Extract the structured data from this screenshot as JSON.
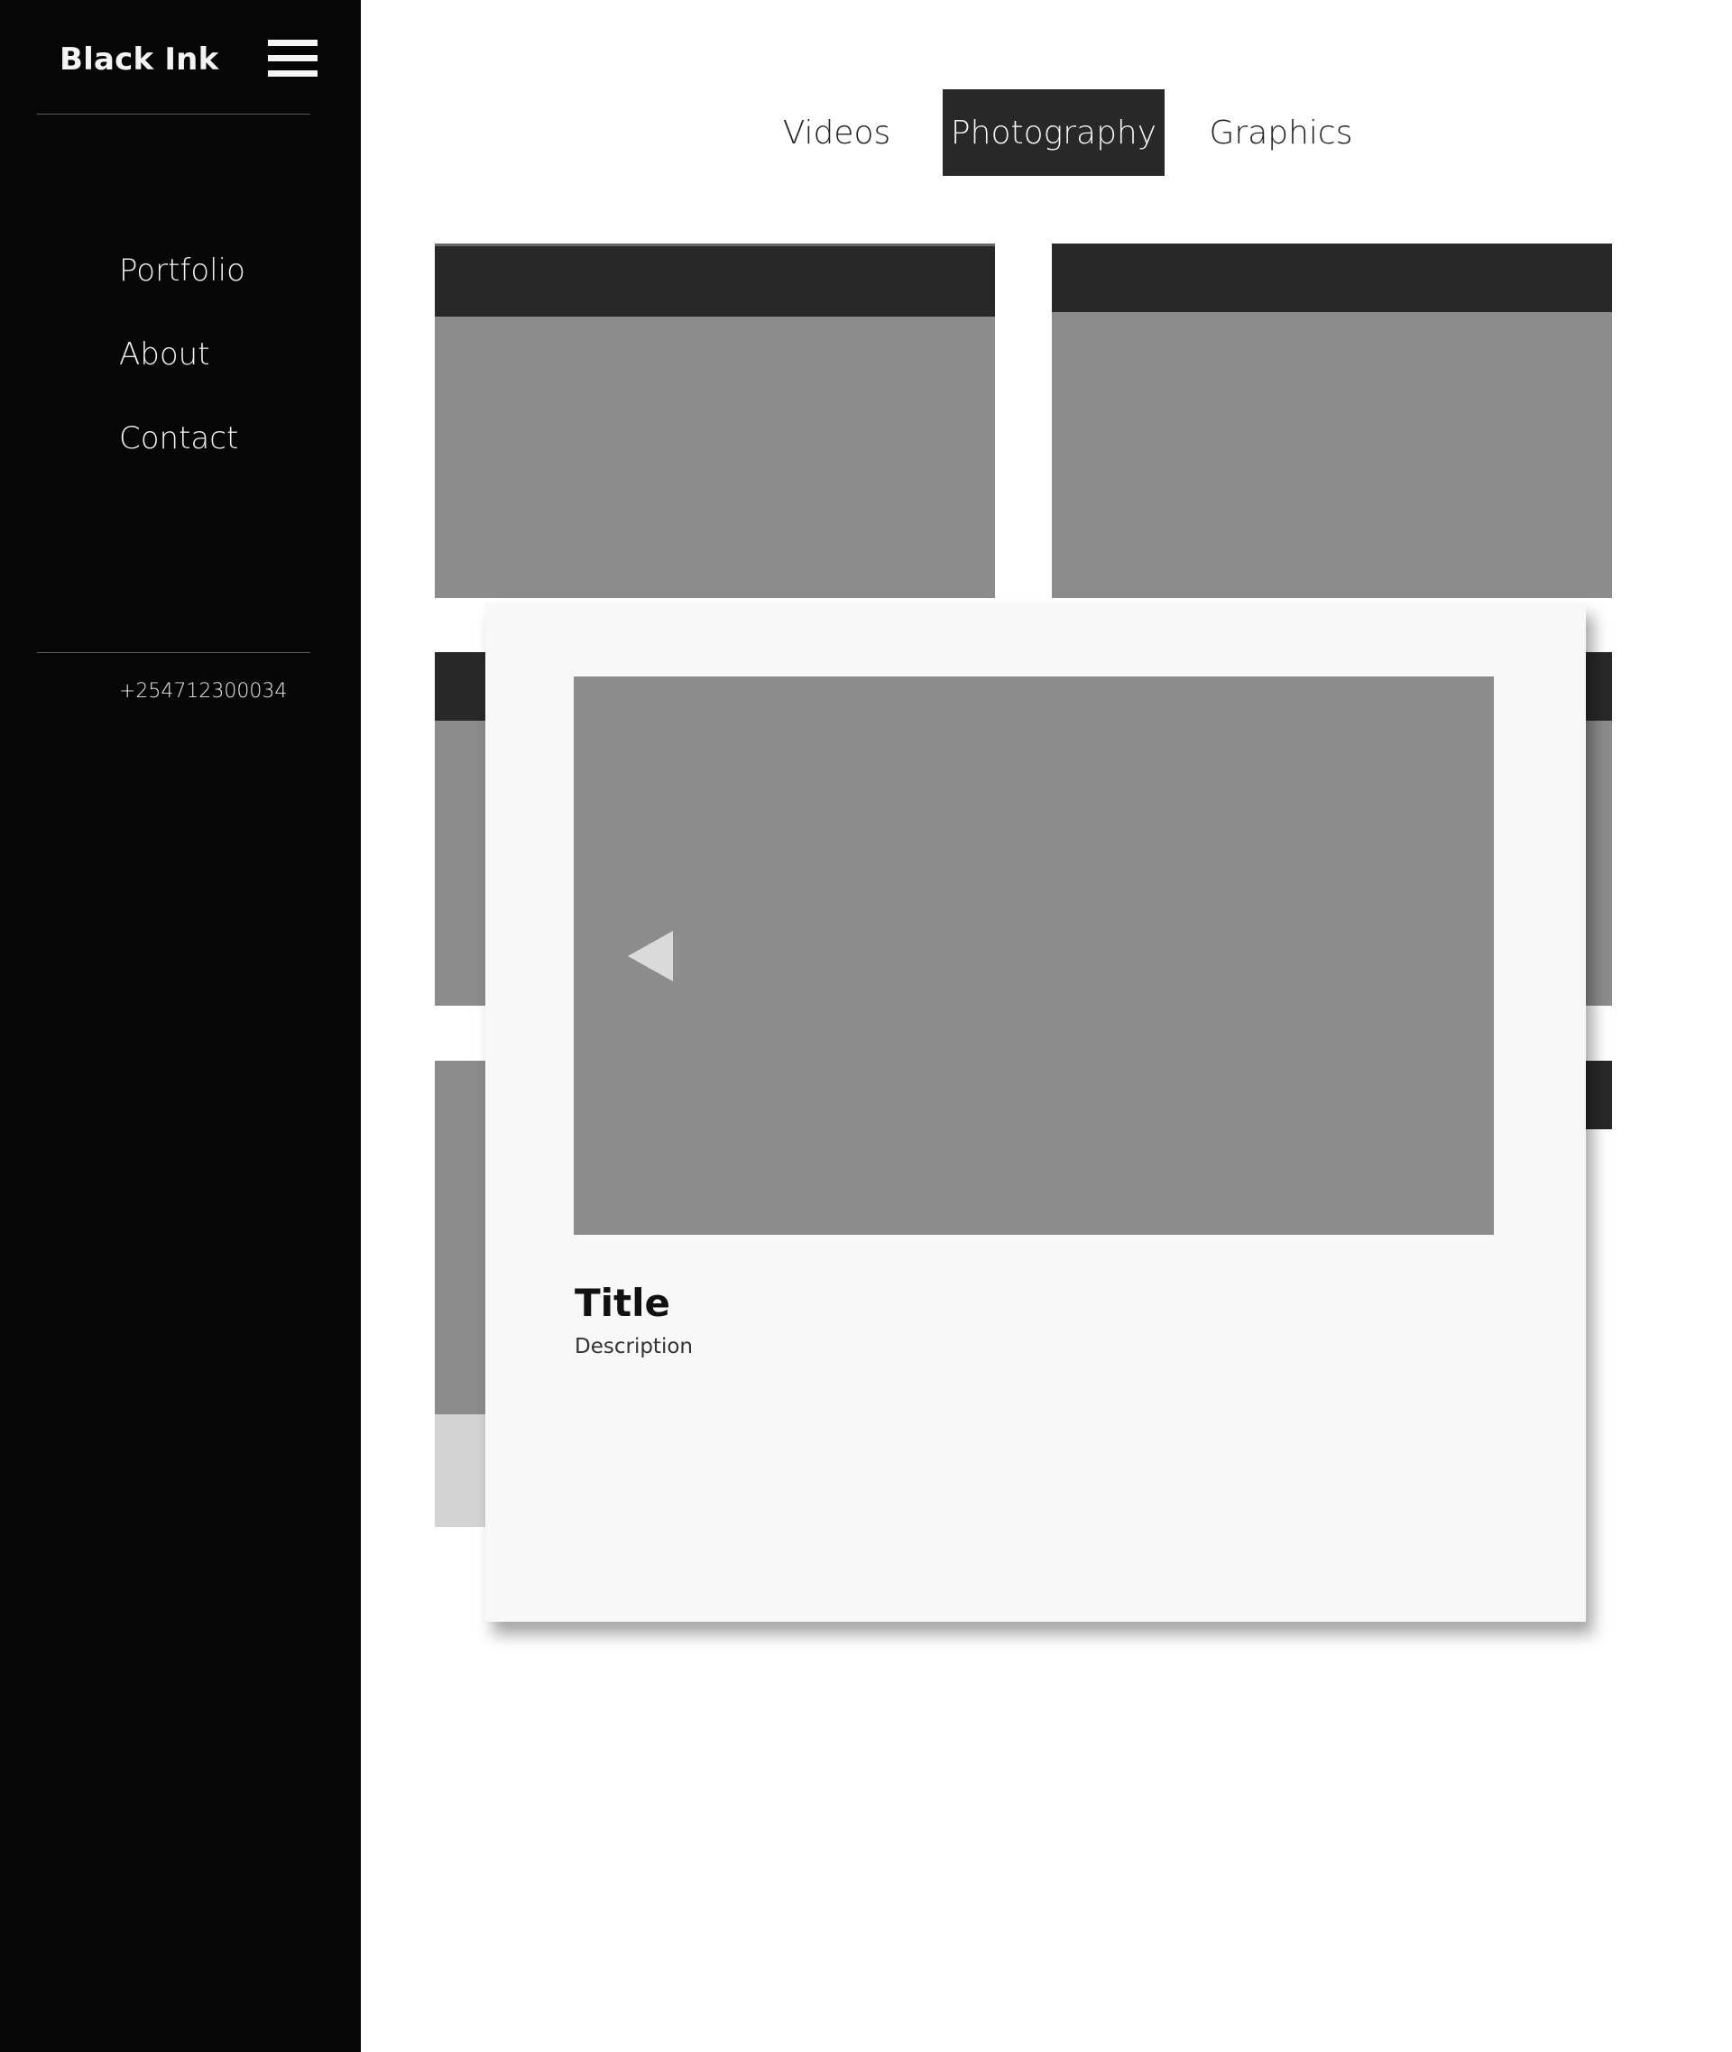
{
  "sidebar": {
    "brand": "Black Ink",
    "nav": [
      {
        "label": "Portfolio"
      },
      {
        "label": "About"
      },
      {
        "label": "Contact"
      }
    ],
    "phone": "+254712300034"
  },
  "tabs": [
    {
      "label": "Videos",
      "active": false
    },
    {
      "label": "Photography",
      "active": true
    },
    {
      "label": "Graphics",
      "active": false
    }
  ],
  "modal": {
    "title": "Title",
    "description": "Description"
  },
  "colors": {
    "sidebar_bg": "#060606",
    "active_tab_bg": "#282828",
    "placeholder_gray": "#8c8c8c",
    "card_header": "#282828",
    "modal_bg": "#f8f8f8"
  }
}
